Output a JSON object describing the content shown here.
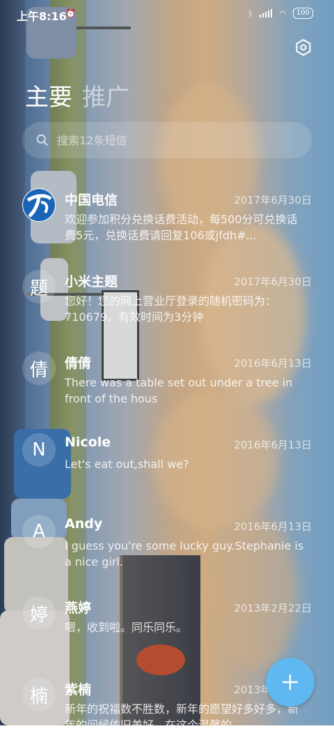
{
  "status_bar": {
    "time": "上午8:16",
    "battery": "100"
  },
  "header": {
    "tab_main": "主要",
    "tab_promo": "推广",
    "settings_icon": "hexagon-settings-icon"
  },
  "search": {
    "placeholder": "搜索12条短信"
  },
  "conversations": [
    {
      "avatar": "",
      "avatar_type": "china-telecom-logo",
      "name": "中国电信",
      "date": "2017年6月30日",
      "preview": "欢迎参加积分兑换话费活动，每500分可兑换话费5元，兑换话费请回复106或jfdh#..."
    },
    {
      "avatar": "题",
      "name": "小米主题",
      "date": "2017年6月30日",
      "preview": "您好！您的网上营业厅登录的随机密码为：710679。有效时间为3分钟"
    },
    {
      "avatar": "倩",
      "name": "倩倩",
      "date": "2016年6月13日",
      "preview": "There was a table set out under a tree in front of the hous"
    },
    {
      "avatar": "N",
      "name": "Nicole",
      "date": "2016年6月13日",
      "preview": "Let's eat out,shall we?"
    },
    {
      "avatar": "A",
      "name": "Andy",
      "date": "2016年6月13日",
      "preview": "I guess you're some lucky guy.Stephanie is a nice girl."
    },
    {
      "avatar": "婷",
      "name": "燕婷",
      "date": "2013年2月22日",
      "preview": "嗯，收到啦。同乐同乐。"
    },
    {
      "avatar": "楠",
      "name": "紫楠",
      "date": "2013年2月22日",
      "preview": "新年的祝福数不胜数，新年的愿望好多好多，新年的问候依旧美好，在这个温馨的"
    }
  ],
  "fab": {
    "icon": "plus-icon",
    "color": "#60b8f0"
  }
}
